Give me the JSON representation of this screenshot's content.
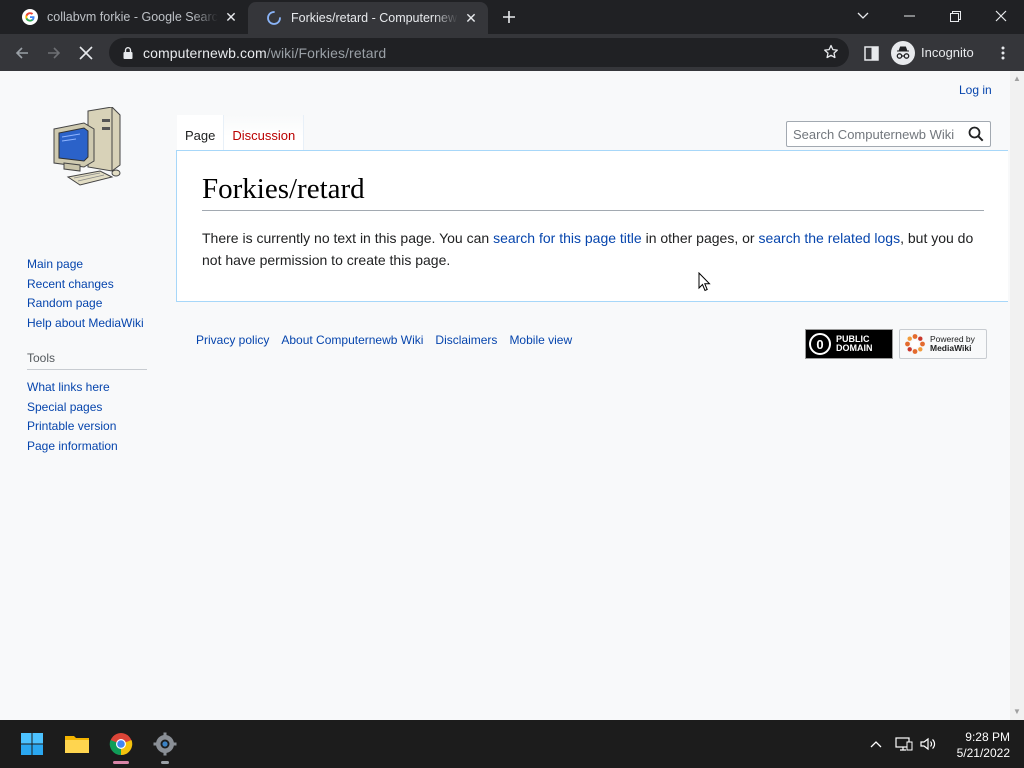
{
  "browser": {
    "tabs": [
      {
        "title": "collabvm forkie - Google Search",
        "favicon": "google-icon",
        "active": false
      },
      {
        "title": "Forkies/retard - Computernewb Wiki",
        "favicon": "loading-spinner-icon",
        "active": true
      }
    ],
    "url_domain": "computernewb.com",
    "url_path": "/wiki/Forkies/retard",
    "incognito_label": "Incognito"
  },
  "page": {
    "login_label": "Log in",
    "tabs": [
      {
        "label": "Page",
        "selected": true
      },
      {
        "label": "Discussion",
        "selected": false,
        "color": "#ba0000"
      }
    ],
    "search_placeholder": "Search Computernewb Wiki",
    "title": "Forkies/retard",
    "body": {
      "text1": "There is currently no text in this page. You can ",
      "link1": "search for this page title",
      "text2": " in other pages, or ",
      "link2": "search the related logs",
      "text3": ", but you do not have permission to create this page."
    },
    "sidebar": {
      "navigation": [
        "Main page",
        "Recent changes",
        "Random page",
        "Help about MediaWiki"
      ],
      "tools_heading": "Tools",
      "tools": [
        "What links here",
        "Special pages",
        "Printable version",
        "Page information"
      ]
    },
    "footer_links": [
      "Privacy policy",
      "About Computernewb Wiki",
      "Disclaimers",
      "Mobile view"
    ],
    "badges": {
      "public_domain": [
        "PUBLIC",
        "DOMAIN"
      ],
      "mediawiki": [
        "Powered by",
        "MediaWiki"
      ]
    },
    "link_color": "#0645ad"
  },
  "taskbar": {
    "apps": [
      "start-icon",
      "file-explorer-icon",
      "chrome-icon",
      "settings-icon"
    ],
    "time": "9:28 PM",
    "date": "5/21/2022"
  }
}
